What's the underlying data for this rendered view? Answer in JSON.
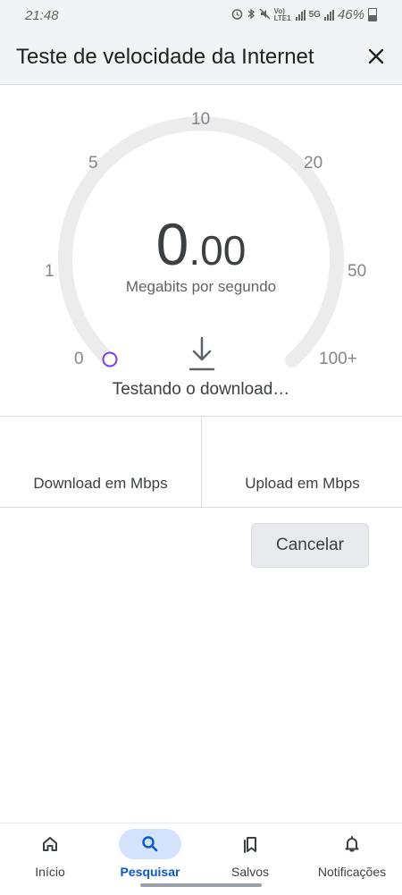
{
  "status_bar": {
    "time": "21:48",
    "battery": "46%",
    "volte": "Vo) LTE1",
    "network": "5G"
  },
  "header": {
    "title": "Teste de velocidade da Internet",
    "close_icon": "close-icon"
  },
  "gauge": {
    "ticks": [
      "0",
      "1",
      "5",
      "10",
      "20",
      "50",
      "100+"
    ],
    "speed_integer": "0",
    "speed_decimal": ".00",
    "unit": "Megabits por segundo",
    "status": "Testando o download…",
    "download_icon": "download-icon",
    "track_color": "#ececec",
    "indicator_color": "#7b3fe4"
  },
  "results": {
    "download_label": "Download em Mbps",
    "upload_label": "Upload em Mbps"
  },
  "actions": {
    "cancel_label": "Cancelar"
  },
  "bottom_nav": {
    "items": [
      {
        "label": "Início",
        "icon": "home-icon",
        "active": false
      },
      {
        "label": "Pesquisar",
        "icon": "search-icon",
        "active": true
      },
      {
        "label": "Salvos",
        "icon": "bookmarks-icon",
        "active": false
      },
      {
        "label": "Notificações",
        "icon": "bell-icon",
        "active": false
      }
    ],
    "accent": "#0b57d0"
  }
}
